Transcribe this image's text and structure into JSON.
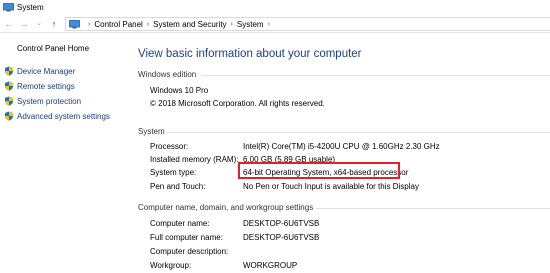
{
  "window": {
    "title": "System"
  },
  "nav": {
    "back": "←",
    "forward": "→",
    "down": "⌄",
    "up": "↑"
  },
  "breadcrumbs": [
    "Control Panel",
    "System and Security",
    "System"
  ],
  "sidebar": {
    "home": "Control Panel Home",
    "items": [
      {
        "label": "Device Manager",
        "icon": "shield-icon"
      },
      {
        "label": "Remote settings",
        "icon": "shield-icon"
      },
      {
        "label": "System protection",
        "icon": "shield-icon"
      },
      {
        "label": "Advanced system settings",
        "icon": "shield-icon"
      }
    ]
  },
  "main": {
    "heading": "View basic information about your computer",
    "edition": {
      "section": "Windows edition",
      "name": "Windows 10 Pro",
      "copyright": "© 2018 Microsoft Corporation. All rights reserved."
    },
    "system": {
      "section": "System",
      "rows": [
        {
          "label": "Processor:",
          "value": "Intel(R) Core(TM) i5-4200U CPU @ 1.60GHz   2.30 GHz"
        },
        {
          "label": "Installed memory (RAM):",
          "value": "6.00 GB (5.89 GB usable)"
        },
        {
          "label": "System type:",
          "value": "64-bit Operating System, x64-based processor"
        },
        {
          "label": "Pen and Touch:",
          "value": "No Pen or Touch Input is available for this Display"
        }
      ]
    },
    "computer": {
      "section": "Computer name, domain, and workgroup settings",
      "rows": [
        {
          "label": "Computer name:",
          "value": "DESKTOP-6U6TVSB"
        },
        {
          "label": "Full computer name:",
          "value": "DESKTOP-6U6TVSB"
        },
        {
          "label": "Computer description:",
          "value": ""
        },
        {
          "label": "Workgroup:",
          "value": "WORKGROUP"
        }
      ]
    }
  },
  "colors": {
    "link": "#1a3f7a",
    "heading": "#1e3f8a",
    "highlight": "#e0202a",
    "accent": "#1f6fc5"
  }
}
